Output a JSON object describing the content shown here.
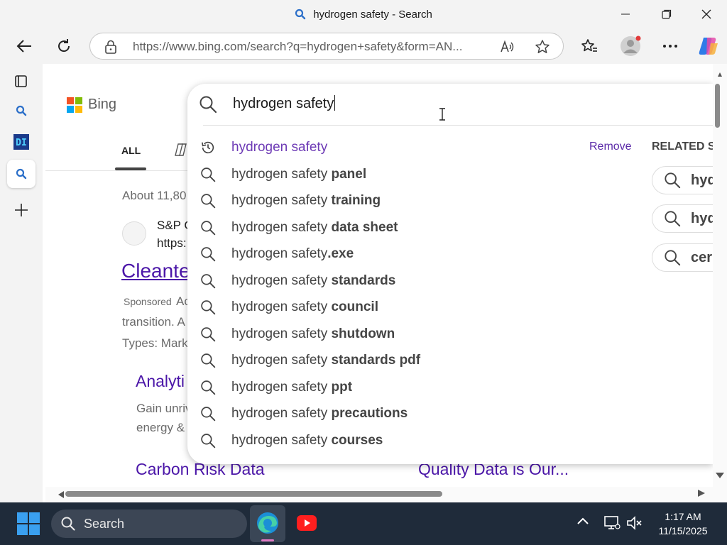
{
  "window": {
    "title": "hydrogen safety - Search"
  },
  "toolbar": {
    "url": "https://www.bing.com/search?q=hydrogen+safety&form=AN..."
  },
  "page": {
    "brand": "Bing",
    "tab_all": "ALL",
    "about_text": "About 11,80",
    "ad_site": "S&P C",
    "ad_url": "https:",
    "ad_title": "Cleante",
    "sponsored": "Sponsored",
    "ad_desc_1": "Ac",
    "ad_desc_2": "transition. A",
    "ad_desc_3": "Types: Mark",
    "sublink_1_title": "Analyti",
    "sublink_1_desc_1": "Gain unriv",
    "sublink_1_desc_2": "energy &",
    "sublink_2_title": "Carbon Risk Data",
    "sublink_3_title": "Quality Data is Our..."
  },
  "search": {
    "query": "hydrogen safety",
    "remove_label": "Remove",
    "related_title": "RELATED SE",
    "suggestions": [
      {
        "prefix": "hydrogen safety",
        "bold": ""
      },
      {
        "prefix": "hydrogen safety ",
        "bold": "panel"
      },
      {
        "prefix": "hydrogen safety ",
        "bold": "training"
      },
      {
        "prefix": "hydrogen safety ",
        "bold": "data sheet"
      },
      {
        "prefix": "hydrogen safety",
        "bold": ".exe"
      },
      {
        "prefix": "hydrogen safety ",
        "bold": "standards"
      },
      {
        "prefix": "hydrogen safety ",
        "bold": "council"
      },
      {
        "prefix": "hydrogen safety ",
        "bold": "shutdown"
      },
      {
        "prefix": "hydrogen safety ",
        "bold": "standards pdf"
      },
      {
        "prefix": "hydrogen safety ",
        "bold": "ppt"
      },
      {
        "prefix": "hydrogen safety ",
        "bold": "precautions"
      },
      {
        "prefix": "hydrogen safety ",
        "bold": "courses"
      }
    ],
    "related": [
      "hyd",
      "hyd",
      "cer"
    ]
  },
  "taskbar": {
    "search_label": "Search",
    "time": "1:17 AM",
    "date": "11/15/2025"
  },
  "colors": {
    "accent_purple": "#4b16a8",
    "history_purple": "#6d3ab5",
    "taskbar_bg": "#1f2b3a"
  }
}
